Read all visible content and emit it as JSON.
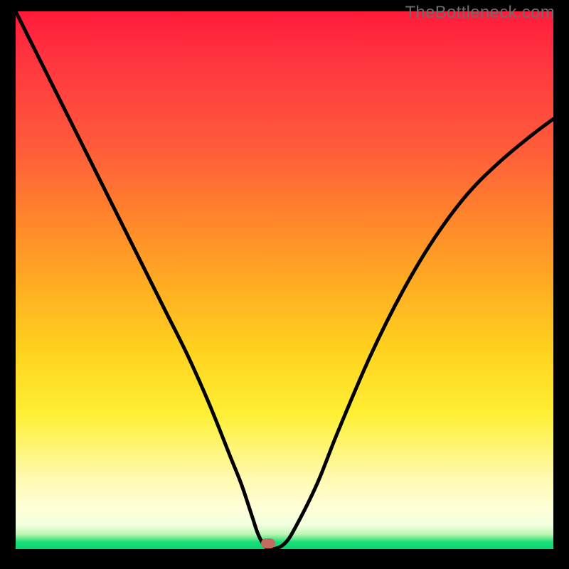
{
  "watermark": {
    "label": "TheBottleneck.com"
  },
  "colors": {
    "gradient_top": "#ff1a3a",
    "gradient_mid": "#ffd21e",
    "gradient_bottom": "#0fd572",
    "curve": "#000000",
    "marker": "#c46a5f",
    "frame": "#000000"
  },
  "chart_data": {
    "type": "line",
    "title": "",
    "xlabel": "",
    "ylabel": "",
    "xlim": [
      0,
      100
    ],
    "ylim": [
      0,
      100
    ],
    "note": "A V-shaped bottleneck curve minimized near x≈47. Background gradient runs from red (high bottleneck) through orange/yellow to a thin green band at the bottom (no bottleneck). The marker sits at the curve minimum on the green band.",
    "series": [
      {
        "name": "bottleneck-curve",
        "x": [
          0,
          4,
          8,
          12,
          16,
          20,
          24,
          28,
          32,
          36,
          40,
          42,
          44,
          45,
          46,
          47,
          48,
          50,
          52,
          56,
          60,
          66,
          72,
          78,
          84,
          90,
          96,
          100
        ],
        "y": [
          100,
          92,
          84,
          76,
          68,
          60,
          52,
          44,
          36,
          27,
          17,
          12,
          6,
          3,
          1,
          0,
          0,
          1,
          4,
          12,
          22,
          36,
          48,
          58,
          66,
          72,
          77,
          80
        ]
      }
    ],
    "marker": {
      "x": 47,
      "y": 0
    }
  }
}
